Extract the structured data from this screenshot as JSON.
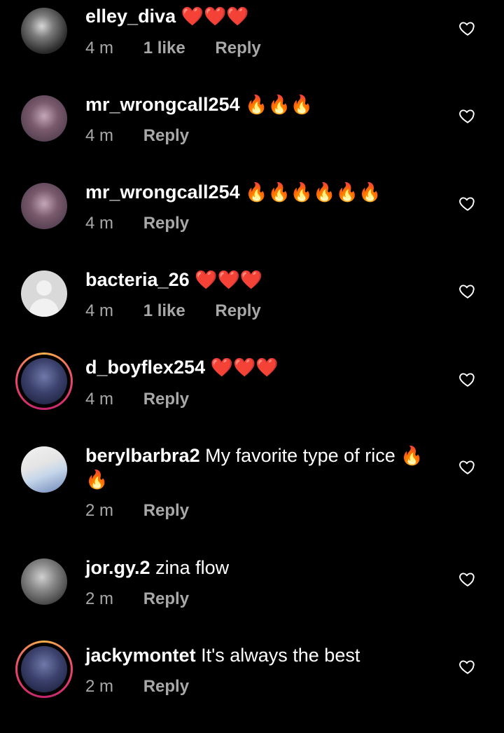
{
  "comments": [
    {
      "username": "elley_diva",
      "text": "",
      "emoji": "❤️❤️❤️",
      "time": "4 m",
      "likes": "1 like",
      "reply": "Reply"
    },
    {
      "username": "mr_wrongcall254",
      "text": "",
      "emoji": "🔥🔥🔥",
      "time": "4 m",
      "likes": "",
      "reply": "Reply"
    },
    {
      "username": "mr_wrongcall254",
      "text": "",
      "emoji": "🔥🔥🔥🔥🔥🔥",
      "time": "4 m",
      "likes": "",
      "reply": "Reply"
    },
    {
      "username": "bacteria_26",
      "text": "",
      "emoji": "❤️❤️❤️",
      "time": "4 m",
      "likes": "1 like",
      "reply": "Reply"
    },
    {
      "username": "d_boyflex254",
      "text": "",
      "emoji": "❤️❤️❤️",
      "time": "4 m",
      "likes": "",
      "reply": "Reply"
    },
    {
      "username": "berylbarbra2",
      "text": "My favorite type of rice",
      "emoji": "🔥",
      "emoji_line2": "🔥",
      "time": "2 m",
      "likes": "",
      "reply": "Reply"
    },
    {
      "username": "jor.gy.2",
      "text": "zina flow",
      "emoji": "",
      "time": "2 m",
      "likes": "",
      "reply": "Reply"
    },
    {
      "username": "jackymontet",
      "text": "It's always the best",
      "emoji": "",
      "time": "2 m",
      "likes": "",
      "reply": "Reply"
    }
  ],
  "icons": {
    "like": "heart-outline-icon"
  },
  "colors": {
    "background": "#000000",
    "text": "#ffffff",
    "meta": "#a8a8a8",
    "story_ring": "#e9456b"
  }
}
